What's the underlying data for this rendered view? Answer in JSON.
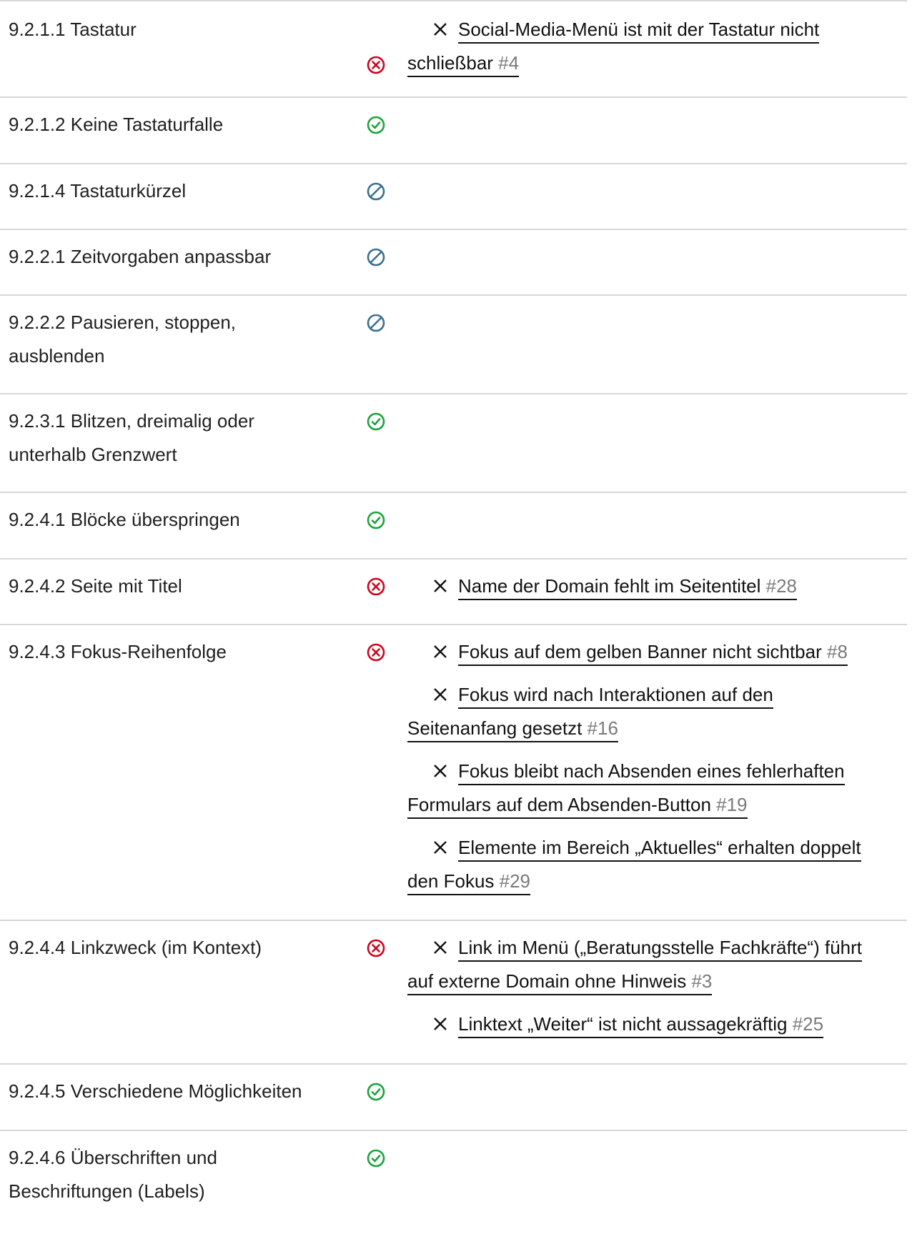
{
  "rows": [
    {
      "criterion": "9.2.1.1 Tastatur",
      "status": "fail",
      "issues": [
        {
          "line1": "Social-Media-Menü ist mit der Tastatur nicht",
          "line2": "schließbar",
          "number": "#4"
        }
      ]
    },
    {
      "criterion": "9.2.1.2 Keine Tastaturfalle",
      "status": "pass",
      "issues": []
    },
    {
      "criterion": "9.2.1.4 Tastaturkürzel",
      "status": "not-applicable",
      "issues": []
    },
    {
      "criterion": "9.2.2.1 Zeitvorgaben anpassbar",
      "status": "not-applicable",
      "issues": []
    },
    {
      "criterion_line1": "9.2.2.2 Pausieren, stoppen,",
      "criterion_line2": "ausblenden",
      "status": "not-applicable",
      "issues": []
    },
    {
      "criterion_line1": "9.2.3.1 Blitzen, dreimalig oder",
      "criterion_line2": "unterhalb Grenzwert",
      "status": "pass",
      "issues": []
    },
    {
      "criterion": "9.2.4.1 Blöcke überspringen",
      "status": "pass",
      "issues": []
    },
    {
      "criterion": "9.2.4.2 Seite mit Titel",
      "status": "fail",
      "issues": [
        {
          "line1": "Name der Domain fehlt im Seitentitel",
          "number": "#28"
        }
      ]
    },
    {
      "criterion": "9.2.4.3 Fokus-Reihenfolge",
      "status": "fail",
      "issues": [
        {
          "line1": "Fokus auf dem gelben Banner nicht sichtbar",
          "number": "#8"
        },
        {
          "line1": "Fokus wird nach Interaktionen auf den",
          "line2": "Seitenanfang gesetzt",
          "number": "#16"
        },
        {
          "line1": "Fokus bleibt nach Absenden eines fehlerhaften",
          "line2": "Formulars auf dem Absenden-Button",
          "number": "#19"
        },
        {
          "line1": "Elemente im Bereich „Aktuelles“ erhalten doppelt",
          "line2": "den Fokus",
          "number": "#29"
        }
      ]
    },
    {
      "criterion": "9.2.4.4 Linkzweck (im Kontext)",
      "status": "fail",
      "issues": [
        {
          "line1": "Link im Menü („Beratungsstelle Fachkräfte“) führt",
          "line2": "auf externe Domain ohne Hinweis",
          "number": "#3"
        },
        {
          "line1": "Linktext „Weiter“ ist nicht aussagekräftig",
          "number": "#25"
        }
      ]
    },
    {
      "criterion": "9.2.4.5 Verschiedene Möglichkeiten",
      "status": "pass",
      "issues": []
    },
    {
      "criterion_line1": "9.2.4.6 Überschriften und",
      "criterion_line2": "Beschriftungen (Labels)",
      "status": "pass",
      "issues": []
    }
  ],
  "colors": {
    "fail": "#d0021b",
    "pass": "#1aa33b",
    "not_applicable": "#3b6f8f",
    "divider": "#d7d7d7"
  },
  "icons": {
    "fail": "x-circle-icon",
    "pass": "check-circle-icon",
    "not_applicable": "slash-circle-icon",
    "issue": "close-x-icon"
  }
}
